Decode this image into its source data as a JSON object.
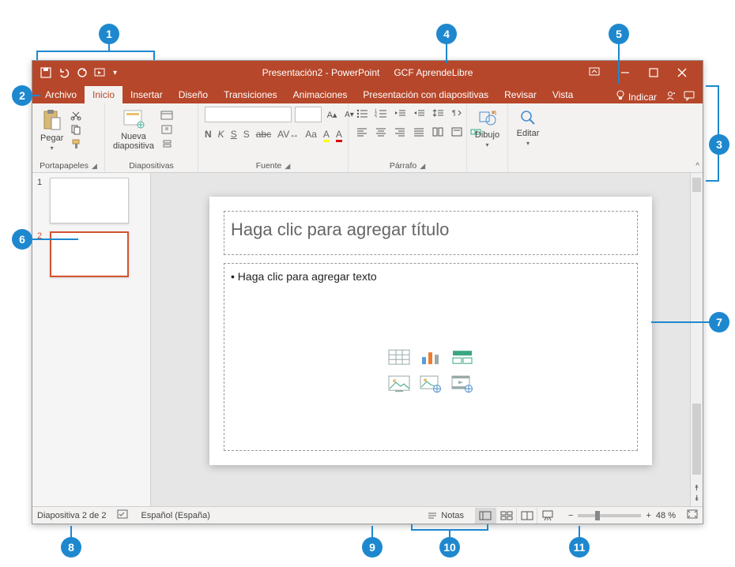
{
  "titlebar": {
    "doc_title": "Presentación2  -  PowerPoint",
    "account": "GCF AprendeLibre"
  },
  "tabs": {
    "archivo": "Archivo",
    "inicio": "Inicio",
    "insertar": "Insertar",
    "diseno": "Diseño",
    "transiciones": "Transiciones",
    "animaciones": "Animaciones",
    "presentacion": "Presentación con diapositivas",
    "revisar": "Revisar",
    "vista": "Vista",
    "indicar": "Indicar"
  },
  "ribbon": {
    "portapapeles": {
      "label": "Portapapeles",
      "pegar": "Pegar"
    },
    "diapositivas": {
      "label": "Diapositivas",
      "nueva": "Nueva\ndiapositiva"
    },
    "fuente": {
      "label": "Fuente",
      "n": "N",
      "k": "K",
      "s_btn": "S",
      "s2": "S",
      "abc": "abc",
      "av": "AV",
      "aa": "Aa",
      "a_up": "A",
      "a_color": "A"
    },
    "parrafo": {
      "label": "Párrafo"
    },
    "dibujo": {
      "label": "Dibujo"
    },
    "editar": {
      "label": "Editar"
    }
  },
  "thumbs": {
    "n1": "1",
    "n2": "2"
  },
  "slide": {
    "title_placeholder": "Haga clic para agregar título",
    "body_placeholder": "• Haga clic para agregar texto"
  },
  "status": {
    "slide_counter": "Diapositiva 2 de 2",
    "language": "Español (España)",
    "notas": "Notas",
    "zoom_pct": "48 %",
    "minus": "−",
    "plus": "+"
  },
  "callouts": {
    "c1": "1",
    "c2": "2",
    "c3": "3",
    "c4": "4",
    "c5": "5",
    "c6": "6",
    "c7": "7",
    "c8": "8",
    "c9": "9",
    "c10": "10",
    "c11": "11"
  }
}
